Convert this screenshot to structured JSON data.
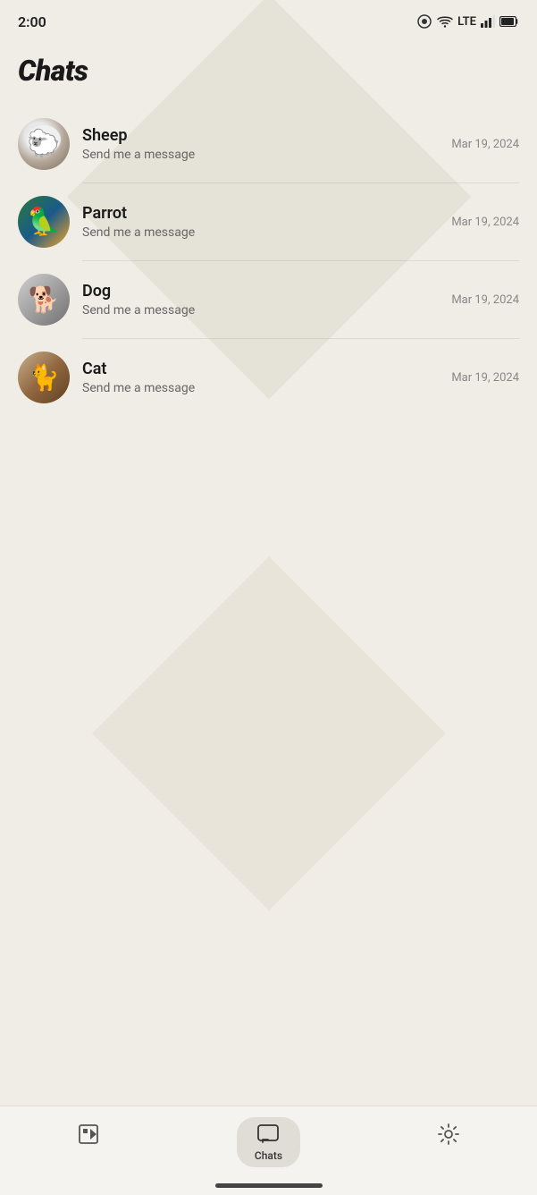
{
  "statusBar": {
    "time": "2:00",
    "cameraIcon": "camera-icon",
    "wifiIcon": "wifi-icon",
    "lteLabel": "LTE",
    "signalIcon": "signal-icon",
    "batteryIcon": "battery-icon"
  },
  "header": {
    "title": "Chats"
  },
  "chats": [
    {
      "id": "sheep",
      "name": "Sheep",
      "preview": "Send me a message",
      "date": "Mar 19, 2024",
      "avatarClass": "avatar-sheep"
    },
    {
      "id": "parrot",
      "name": "Parrot",
      "preview": "Send me a message",
      "date": "Mar 19, 2024",
      "avatarClass": "avatar-parrot"
    },
    {
      "id": "dog",
      "name": "Dog",
      "preview": "Send me a message",
      "date": "Mar 19, 2024",
      "avatarClass": "avatar-dog"
    },
    {
      "id": "cat",
      "name": "Cat",
      "preview": "Send me a message",
      "date": "Mar 19, 2024",
      "avatarClass": "avatar-cat"
    }
  ],
  "bottomNav": {
    "items": [
      {
        "id": "library",
        "label": "",
        "icon": "library-icon",
        "active": false
      },
      {
        "id": "chats",
        "label": "Chats",
        "icon": "chats-icon",
        "active": true
      },
      {
        "id": "settings",
        "label": "",
        "icon": "settings-icon",
        "active": false
      }
    ]
  }
}
